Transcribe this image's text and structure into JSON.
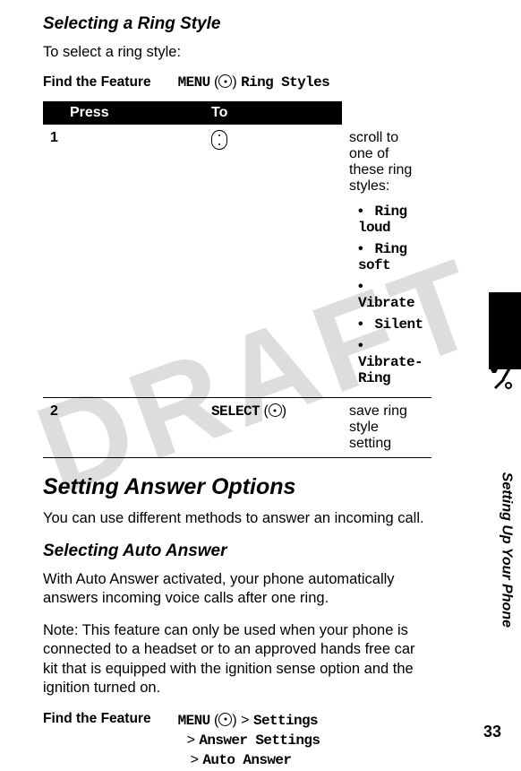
{
  "watermark": "DRAFT",
  "sidebar_label": "Setting Up Your Phone",
  "page_number": "33",
  "section1": {
    "title": "Selecting a Ring Style",
    "intro": "To select a ring style:",
    "find_feature_label": "Find the Feature",
    "find_feature_value_menu": "MENU",
    "find_feature_value_rest": "Ring Styles",
    "table_header_press": "Press",
    "table_header_to": "To",
    "row1": {
      "num": "1",
      "press": "",
      "to": "scroll to one of these ring styles:",
      "items": [
        "Ring loud",
        "Ring soft",
        "Vibrate",
        "Silent",
        "Vibrate-Ring"
      ]
    },
    "row2": {
      "num": "2",
      "press_text": "SELECT",
      "to": "save ring style setting"
    }
  },
  "section2": {
    "title": "Setting Answer Options",
    "intro": "You can use different methods to answer an incoming call.",
    "subtitle": "Selecting Auto Answer",
    "body1": "With Auto Answer activated, your phone automatically answers incoming voice calls after one ring.",
    "note_label": "Note:",
    "note_text": " This feature can only be used when your phone is connected to a headset or to an approved hands free car kit that is equipped with the ignition sense option and the ignition turned on.",
    "find_feature_label": "Find the Feature",
    "path_menu": "MENU",
    "path_line1_rest": "Settings",
    "path_line2": "Answer Settings",
    "path_line3": "Auto Answer"
  }
}
